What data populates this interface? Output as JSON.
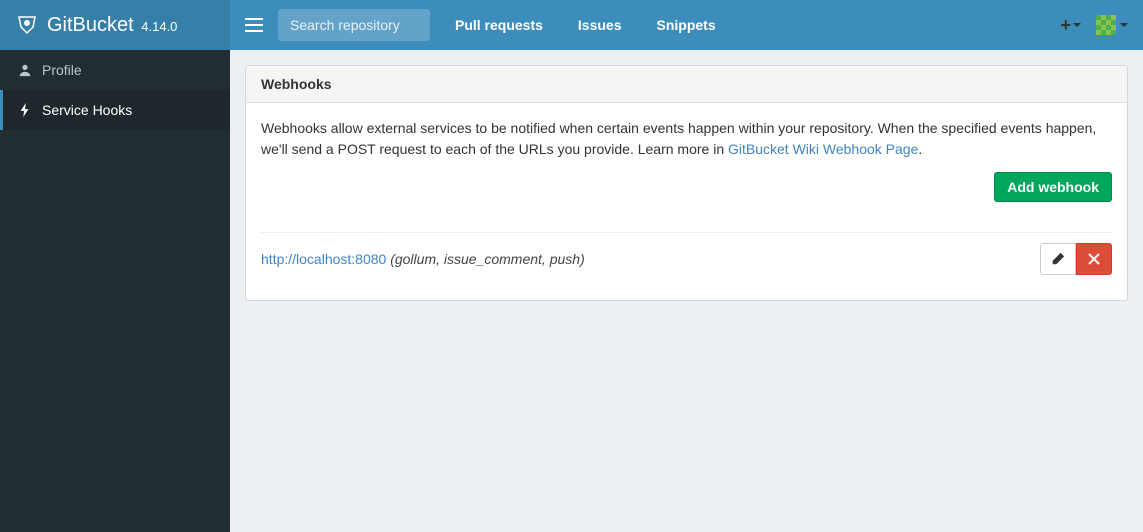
{
  "brand": {
    "name": "GitBucket",
    "version": "4.14.0"
  },
  "search": {
    "placeholder": "Search repository"
  },
  "nav": {
    "pull_requests": "Pull requests",
    "issues": "Issues",
    "snippets": "Snippets"
  },
  "sidebar": {
    "profile": "Profile",
    "service_hooks": "Service Hooks"
  },
  "panel": {
    "title": "Webhooks",
    "description_1": "Webhooks allow external services to be notified when certain events happen within your repository. When the specified events happen, we'll send a POST request to each of the URLs you provide. Learn more in ",
    "description_link": "GitBucket Wiki Webhook Page",
    "description_2": ".",
    "add_button": "Add webhook"
  },
  "hooks": [
    {
      "url": "http://localhost:8080",
      "events": " (gollum, issue_comment, push)"
    }
  ]
}
